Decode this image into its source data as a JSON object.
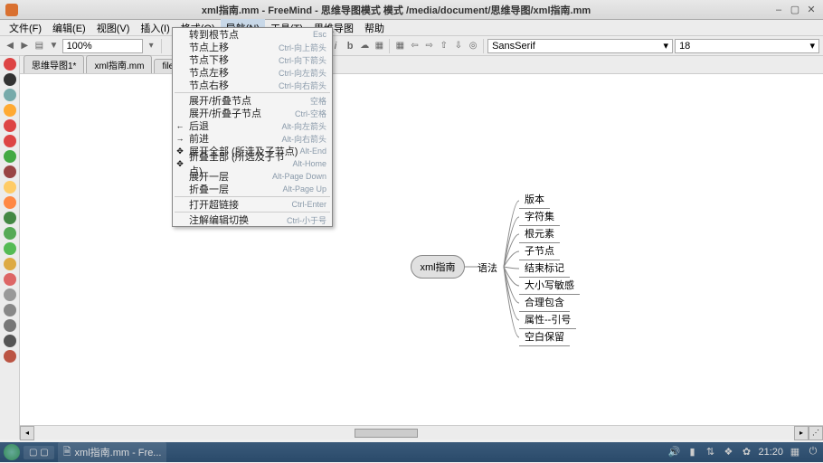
{
  "title": "xml指南.mm - FreeMind - 思维导图模式 模式 /media/document/思维导图/xml指南.mm",
  "menus": [
    "文件(F)",
    "编辑(E)",
    "视图(V)",
    "插入(I)",
    "格式(O)",
    "导航(N)",
    "工具(T)",
    "思维导图",
    "帮助"
  ],
  "active_menu_index": 5,
  "zoom": "100%",
  "font_name": "SansSerif",
  "font_size": "18",
  "tabs": [
    "思维导图1*",
    "xml指南.mm",
    "file:/u"
  ],
  "root": "xml指南",
  "midlabel": "语法",
  "children": [
    "版本",
    "字符集",
    "根元素",
    "子节点",
    "结束标记",
    "大小写敏感",
    "合理包含",
    "属性--引号",
    "空白保留"
  ],
  "dropdown": {
    "groups": [
      [
        {
          "label": "转到根节点",
          "shortcut": "Esc"
        },
        {
          "label": "节点上移",
          "shortcut": "Ctrl-向上箭头"
        },
        {
          "label": "节点下移",
          "shortcut": "Ctrl-向下箭头"
        },
        {
          "label": "节点左移",
          "shortcut": "Ctrl-向左箭头"
        },
        {
          "label": "节点右移",
          "shortcut": "Ctrl-向右箭头"
        }
      ],
      [
        {
          "label": "展开/折叠节点",
          "shortcut": "空格"
        },
        {
          "label": "展开/折叠子节点",
          "shortcut": "Ctrl-空格"
        },
        {
          "icon": "←",
          "label": "后退",
          "shortcut": "Alt-向左箭头"
        },
        {
          "icon": "→",
          "label": "前进",
          "shortcut": "Alt-向右箭头"
        },
        {
          "icon": "✥",
          "label": "展开全部 (所选及子节点)",
          "shortcut": "Alt-End"
        },
        {
          "icon": "✥",
          "label": "折叠全部 (所选及子节点)",
          "shortcut": "Alt-Home"
        },
        {
          "label": "展开一层",
          "shortcut": "Alt-Page Down"
        },
        {
          "label": "折叠一层",
          "shortcut": "Alt-Page Up"
        }
      ],
      [
        {
          "label": "打开超链接",
          "shortcut": "Ctrl-Enter"
        }
      ],
      [
        {
          "label": "注解编辑切换",
          "shortcut": "Ctrl-小于号"
        }
      ]
    ]
  },
  "left_colors": [
    "#d44",
    "#333",
    "#7aa",
    "#fa3",
    "#d44",
    "#d44",
    "#4a4",
    "#944",
    "#fc6",
    "#f84",
    "#484",
    "#5a5",
    "#5b5",
    "#da4",
    "#d66",
    "#999",
    "#888",
    "#777",
    "#555",
    "#b54"
  ],
  "taskbar_app": "xml指南.mm - Fre...",
  "clock": "21:20",
  "tray_battery_icon": "▮",
  "tray_sound_icon": "🔊",
  "tray_net_icon": "⇅"
}
